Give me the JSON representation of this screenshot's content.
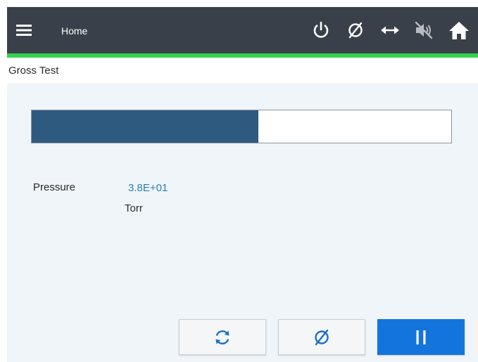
{
  "header": {
    "home_label": "Home",
    "icons": [
      "menu-icon",
      "power-icon",
      "zero-icon",
      "horizontal-arrows-icon",
      "sound-muted-icon",
      "home-icon"
    ]
  },
  "page": {
    "title": "Gross Test"
  },
  "progress": {
    "fraction": 0.54
  },
  "pressure": {
    "label": "Pressure",
    "value": "3.8E+01",
    "unit": "Torr"
  },
  "actions": {
    "icons": [
      "refresh-icon",
      "zero-icon",
      "pause-icon"
    ]
  },
  "colors": {
    "header_bg": "#394049",
    "accent_green": "#31d24a",
    "progress_fill": "#2f5a80",
    "value_blue": "#2c7fb3",
    "primary_button": "#1474dd",
    "content_bg": "#eff5f8"
  }
}
